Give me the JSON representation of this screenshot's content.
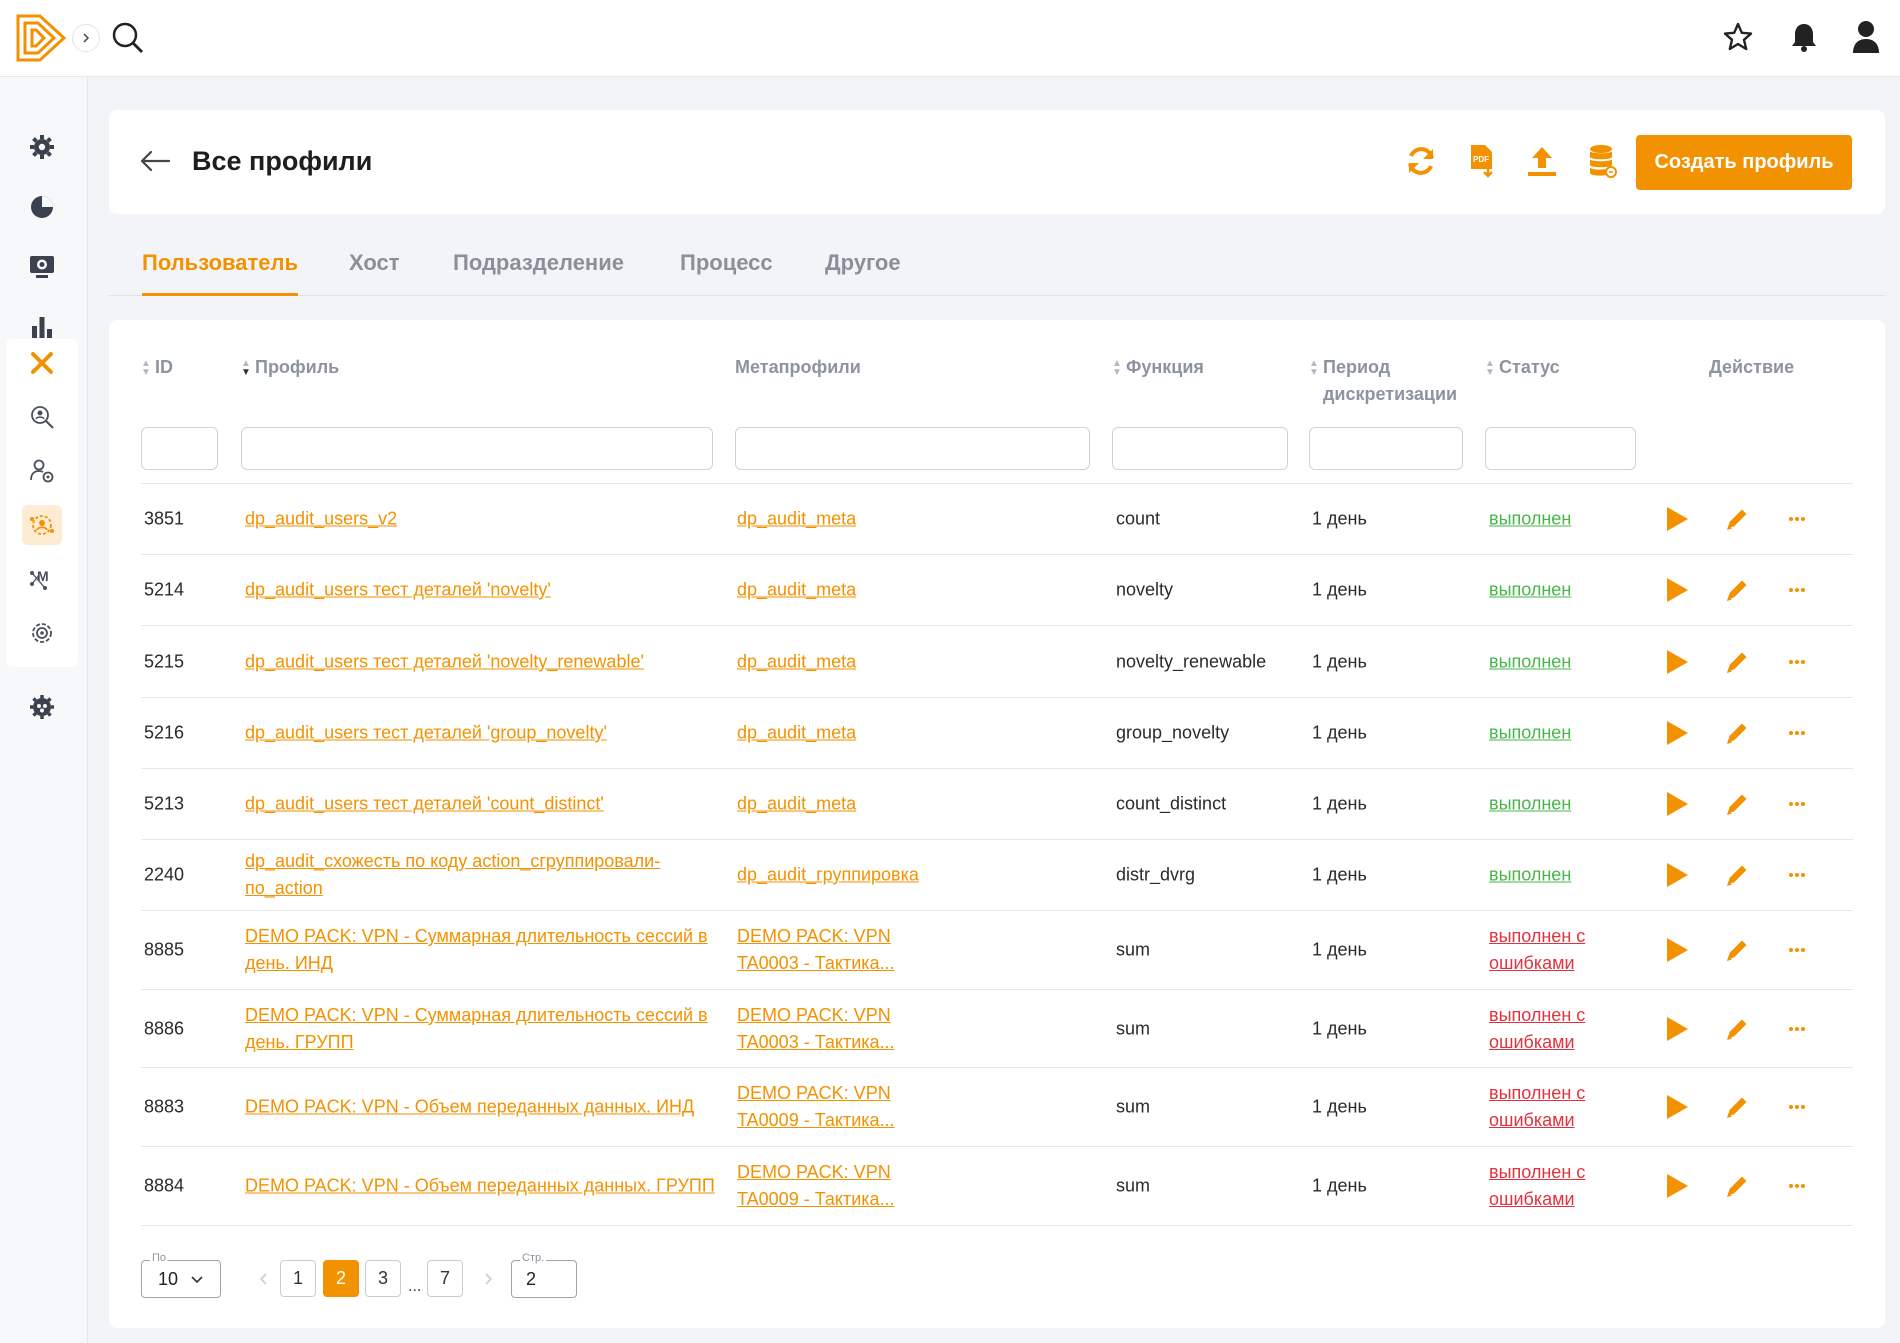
{
  "header": {
    "title": "Все профили",
    "create_label": "Создать профиль",
    "brand_color": "#f39200"
  },
  "tabs": [
    {
      "label": "Пользователь",
      "active": true
    },
    {
      "label": "Хост",
      "active": false
    },
    {
      "label": "Подразделение",
      "active": false
    },
    {
      "label": "Процесс",
      "active": false
    },
    {
      "label": "Другое",
      "active": false
    }
  ],
  "table": {
    "columns": {
      "id": "ID",
      "profile": "Профиль",
      "meta": "Метапрофили",
      "function": "Функция",
      "period_1": "Период",
      "period_2": "дискретизации",
      "status": "Статус",
      "action": "Действие"
    },
    "rows": [
      {
        "id": "3851",
        "profile": "dp_audit_users_v2",
        "profile_2": "",
        "meta": "dp_audit_meta",
        "meta_2": "",
        "function": "count",
        "period": "1 день",
        "status": "выполнен",
        "status_2": "",
        "status_type": "ok"
      },
      {
        "id": "5214",
        "profile": "dp_audit_users тест деталей 'novelty'",
        "profile_2": "",
        "meta": "dp_audit_meta",
        "meta_2": "",
        "function": "novelty",
        "period": "1 день",
        "status": "выполнен",
        "status_2": "",
        "status_type": "ok"
      },
      {
        "id": "5215",
        "profile": "dp_audit_users тест деталей 'novelty_renewable'",
        "profile_2": "",
        "meta": "dp_audit_meta",
        "meta_2": "",
        "function": "novelty_renewable",
        "period": "1 день",
        "status": "выполнен",
        "status_2": "",
        "status_type": "ok"
      },
      {
        "id": "5216",
        "profile": "dp_audit_users тест деталей 'group_novelty'",
        "profile_2": "",
        "meta": "dp_audit_meta",
        "meta_2": "",
        "function": "group_novelty",
        "period": "1 день",
        "status": "выполнен",
        "status_2": "",
        "status_type": "ok"
      },
      {
        "id": "5213",
        "profile": "dp_audit_users тест деталей 'count_distinct'",
        "profile_2": "",
        "meta": "dp_audit_meta",
        "meta_2": "",
        "function": "count_distinct",
        "period": "1 день",
        "status": "выполнен",
        "status_2": "",
        "status_type": "ok"
      },
      {
        "id": "2240",
        "profile": "dp_audit_схожесть по коду action_сгруппировали-",
        "profile_2": "по_action",
        "meta": "dp_audit_группировка",
        "meta_2": "",
        "function": "distr_dvrg",
        "period": "1 день",
        "status": "выполнен",
        "status_2": "",
        "status_type": "ok"
      },
      {
        "id": "8885",
        "profile": "DEMO PACK: VPN - Суммарная длительность сессий в",
        "profile_2": "день. ИНД",
        "meta": "DEMO PACK: VPN",
        "meta_2": "TA0003 - Тактика...",
        "function": "sum",
        "period": "1 день",
        "status": "выполнен с",
        "status_2": "ошибками",
        "status_type": "err"
      },
      {
        "id": "8886",
        "profile": "DEMO PACK: VPN - Суммарная длительность сессий в",
        "profile_2": "день. ГРУПП",
        "meta": "DEMO PACK: VPN",
        "meta_2": "TA0003 - Тактика...",
        "function": "sum",
        "period": "1 день",
        "status": "выполнен с",
        "status_2": "ошибками",
        "status_type": "err"
      },
      {
        "id": "8883",
        "profile": "DEMO PACK: VPN - Объем переданных данных. ИНД",
        "profile_2": "",
        "meta": "DEMO PACK: VPN",
        "meta_2": "TA0009 - Тактика...",
        "function": "sum",
        "period": "1 день",
        "status": "выполнен с",
        "status_2": "ошибками",
        "status_type": "err"
      },
      {
        "id": "8884",
        "profile": "DEMO PACK: VPN - Объем переданных данных. ГРУПП",
        "profile_2": "",
        "meta": "DEMO PACK: VPN",
        "meta_2": "TA0009 - Тактика...",
        "function": "sum",
        "period": "1 день",
        "status": "выполнен с",
        "status_2": "ошибками",
        "status_type": "err"
      }
    ]
  },
  "pagination": {
    "per_page_label": "По",
    "per_page_value": "10",
    "pages": [
      "1",
      "2",
      "3",
      "7"
    ],
    "ellipsis": "...",
    "current_page": "2",
    "goto_label": "Стр.",
    "goto_value": "2"
  },
  "icons": {
    "top": [
      "star-icon",
      "bell-icon",
      "user-icon"
    ],
    "header": [
      "refresh-icon",
      "pdf-export-icon",
      "upload-icon",
      "database-icon"
    ],
    "row_actions": [
      "play-icon",
      "edit-icon",
      "more-icon"
    ]
  }
}
